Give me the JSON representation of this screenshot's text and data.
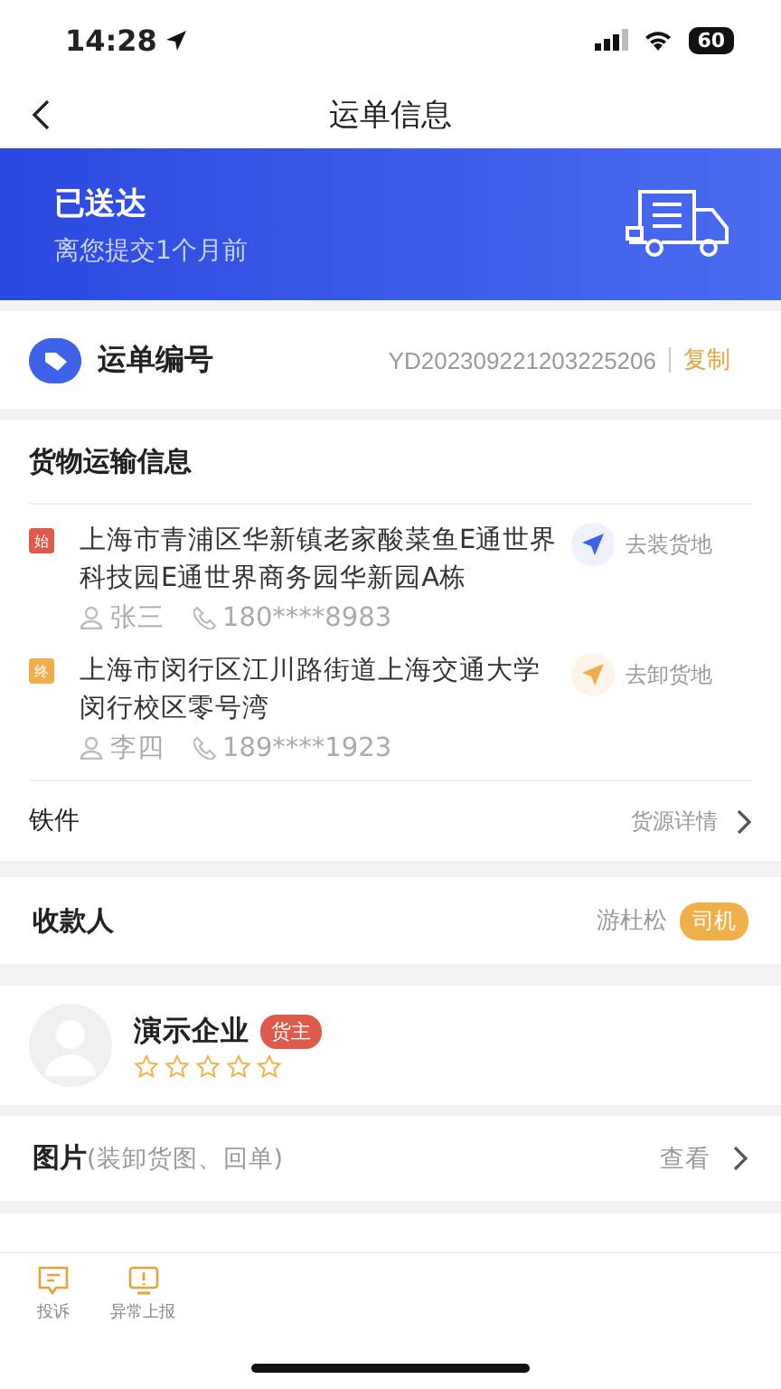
{
  "status_bar": {
    "time": "14:28",
    "battery": "60"
  },
  "nav": {
    "title": "运单信息"
  },
  "banner": {
    "status": "已送达",
    "subtitle": "离您提交1个月前"
  },
  "waybill": {
    "label": "运单编号",
    "number": "YD202309221203225206",
    "copy": "复制"
  },
  "cargo": {
    "title": "货物运输信息",
    "stops": [
      {
        "kind": "start",
        "tag": "始",
        "address": "上海市青浦区华新镇老家酸菜鱼E通世界科技园E通世界商务园华新园A栋",
        "contact": "张三",
        "phone": "180****8983",
        "action": "去装货地"
      },
      {
        "kind": "end",
        "tag": "终",
        "address": "上海市闵行区江川路街道上海交通大学闵行校区零号湾",
        "contact": "李四",
        "phone": "189****1923",
        "action": "去卸货地"
      }
    ],
    "goods": "铁件",
    "details": "货源详情"
  },
  "payee": {
    "label": "收款人",
    "name": "游杜松",
    "role": "司机"
  },
  "company": {
    "name": "演示企业",
    "role": "货主",
    "stars": 0
  },
  "photos": {
    "label": "图片",
    "note": "(装卸货图、回单)",
    "action": "查看"
  },
  "bottom_bar": {
    "items": [
      {
        "kind": "complaint",
        "label": "投诉"
      },
      {
        "kind": "report",
        "label": "异常上报"
      }
    ]
  }
}
